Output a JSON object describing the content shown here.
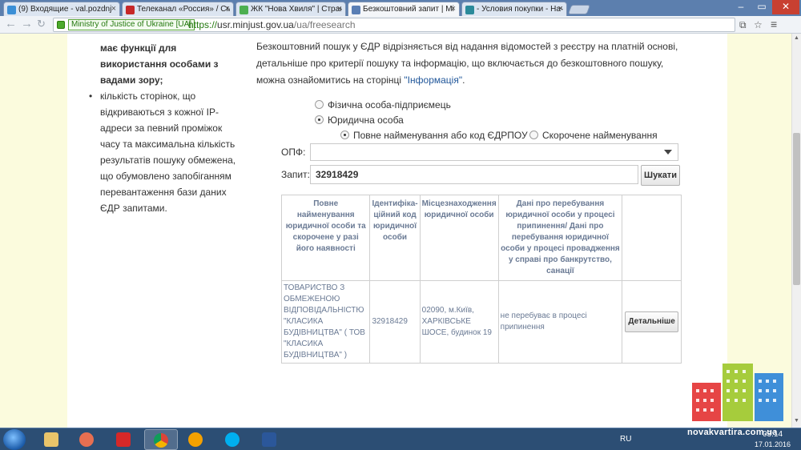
{
  "browser": {
    "tabs": [
      {
        "title": "(9) Входящие - val.pozdnj",
        "color": "#3b8fd6"
      },
      {
        "title": "Телеканал «Россия» / Сме",
        "color": "#c62828"
      },
      {
        "title": "ЖК \"Нова Хвиля\" | Стран",
        "color": "#4caf50"
      },
      {
        "title": "Безкоштовний запит | Мі",
        "color": "#5a7fb5"
      },
      {
        "title": "- Условия покупки - Начи",
        "color": "#2a8a9a"
      }
    ],
    "address": {
      "ev_label": "Ministry of Justice of Ukraine [UA]",
      "url_protocol": "https://",
      "url_host": "usr.minjust.gov.ua",
      "url_path": "/ua/freesearch"
    }
  },
  "sidebar": {
    "intro_bold": "має функції для використання особами з вадами зору;",
    "bullet": "кількість сторінок, що відкриваються з кожної IP-адреси за певний проміжок часу та максимальна кількість результатів пошуку обмежена, що обумовлено запобіганням перевантаження бази даних ЄДР запитами."
  },
  "intro": {
    "text": "Безкоштовний пошук у ЄДР відрізняється від надання відомостей з реєстру на платній основі, детальніше про критерії пошуку та інформацію, що включається до безкоштовного пошуку, можна ознайомитись на сторінці ",
    "link": "\"Інформація\"",
    "tail": "."
  },
  "form": {
    "radio_person": "Фізична особа-підприємець",
    "radio_legal": "Юридична особа",
    "radio_fullname": "Повне найменування або код ЄДРПОУ",
    "radio_short": "Скорочене найменування",
    "opf_label": "ОПФ:",
    "opf_value": "",
    "query_label": "Запит:",
    "query_value": "32918429",
    "search_button": "Шукати"
  },
  "table": {
    "headers": [
      "Повне найменування юридичної особи та скорочене у разі його наявності",
      "Ідентифіка-ційний код юридичної особи",
      "Місцезнаходження юридичної особи",
      "Дані про перебування юридичної особи у процесі припинення/ Дані про перебування юридичної особи у процесі провадження у справі про банкрутство, санації",
      ""
    ],
    "row": {
      "name": "ТОВАРИСТВО З ОБМЕЖЕНОЮ ВІДПОВІДАЛЬНІСТЮ \"КЛАСИКА БУДІВНИЦТВА\" ( ТОВ \"КЛАСИКА БУДІВНИЦТВА\" )",
      "code": "32918429",
      "address": "02090, м.Київ, ХАРКІВСЬКЕ ШОСЕ, будинок 19",
      "status": "не перебуває в процесі припинення",
      "detail_button": "Детальніше"
    }
  },
  "taskbar": {
    "lang": "RU",
    "time": "03:14",
    "date": "17.01.2016"
  },
  "watermark": "novakvartira.com.ua"
}
